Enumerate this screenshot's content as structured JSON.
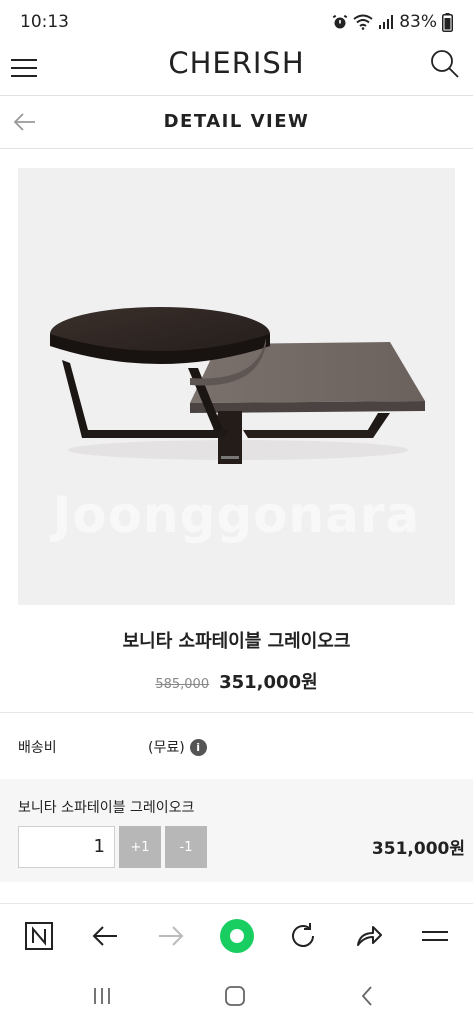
{
  "status_bar": {
    "time": "10:13",
    "battery": "83%",
    "icons": [
      "alarm-icon",
      "wifi-icon",
      "signal-icon",
      "battery-icon"
    ]
  },
  "header": {
    "brand": "CHERISH",
    "menu_icon": "hamburger-menu-icon",
    "search_icon": "search-icon"
  },
  "sub_header": {
    "title": "DETAIL VIEW",
    "back_icon": "arrow-left-icon"
  },
  "product": {
    "watermark": "Joonggonara",
    "name": "보니타 소파테이블 그레이오크",
    "original_price": "585,000",
    "sale_price": "351,000원"
  },
  "shipping": {
    "label": "배송비",
    "value": "(무료)",
    "info_icon": "info-icon"
  },
  "option": {
    "name": "보니타 소파테이블 그레이오크",
    "quantity": "1",
    "plus_label": "+1",
    "minus_label": "-1",
    "total": "351,000원"
  },
  "browser_bar": {
    "icons": [
      "naver-n-icon",
      "back-arrow-icon",
      "forward-arrow-icon",
      "green-home-icon",
      "refresh-icon",
      "share-icon",
      "menu-icon"
    ]
  },
  "nav_bar": {
    "icons": [
      "recent-apps-icon",
      "home-icon",
      "back-icon"
    ]
  },
  "colors": {
    "accent_green": "#19ce60",
    "qty_button": "#b7b7b7",
    "image_bg": "#f1f0f1"
  }
}
